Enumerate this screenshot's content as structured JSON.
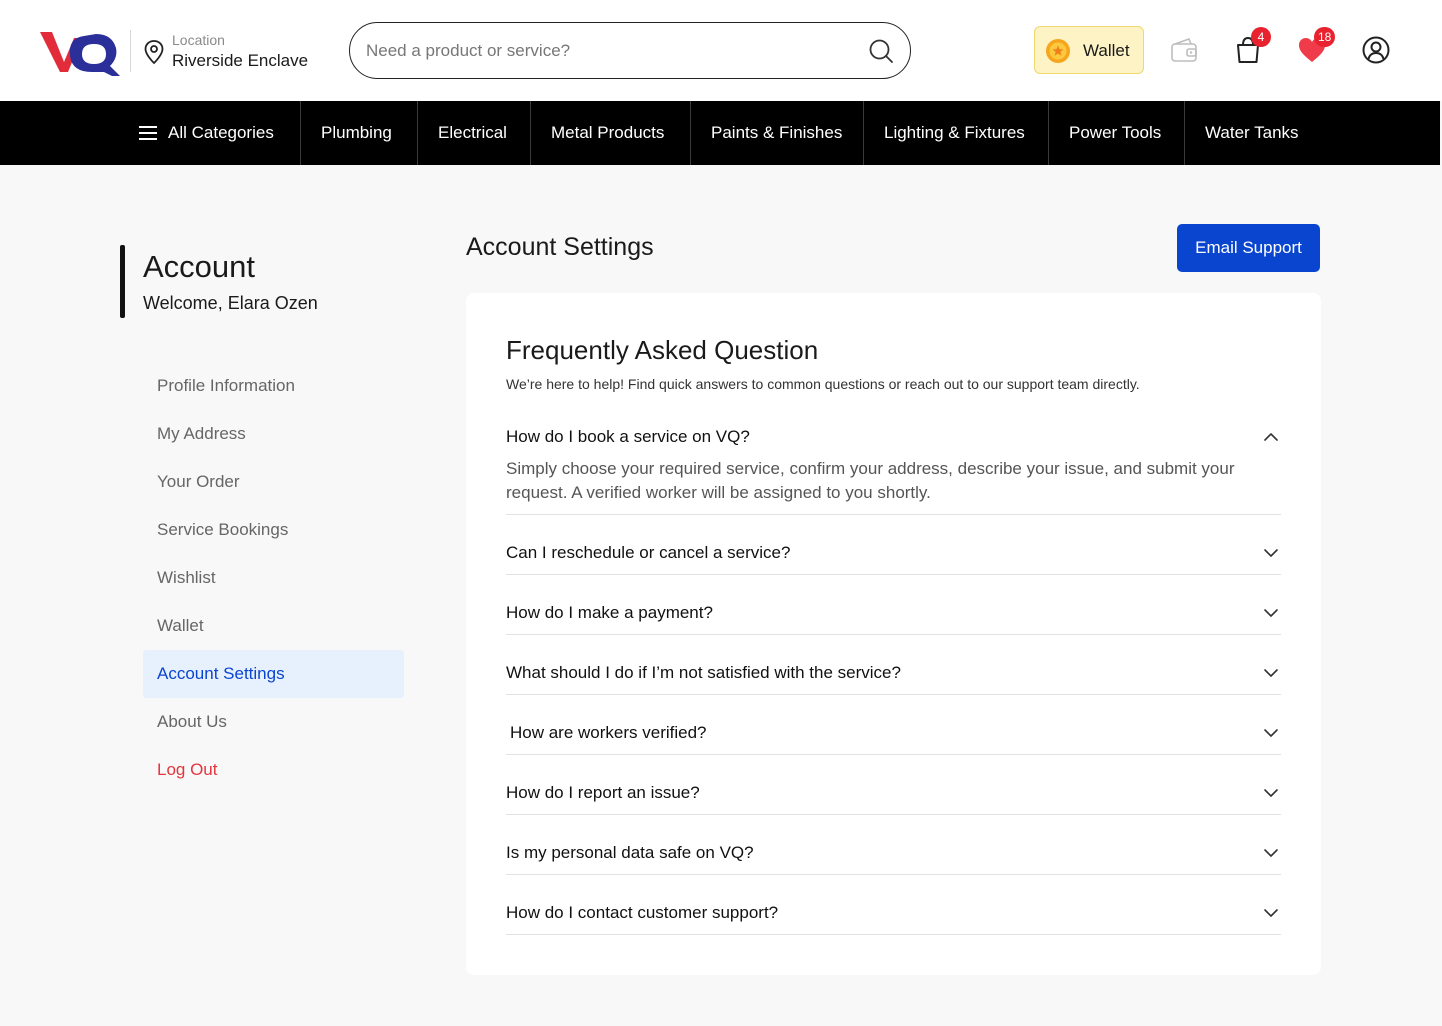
{
  "header": {
    "logo_text": "VQ",
    "location_label": "Location",
    "location_value": "Riverside Enclave",
    "search_placeholder": "Need a product or service?",
    "wallet_label": "Wallet",
    "cart_count": "4",
    "wishlist_count": "18",
    "icons": [
      "location-pin-icon",
      "search-icon",
      "coin-icon",
      "wallet-icon",
      "shopping-bag-icon",
      "heart-icon",
      "user-icon"
    ]
  },
  "nav": {
    "items": [
      "All Categories",
      "Plumbing",
      "Electrical",
      "Metal Products",
      "Paints & Finishes",
      "Lighting & Fixtures",
      "Power Tools",
      "Water Tanks"
    ]
  },
  "sidebar": {
    "title": "Account",
    "welcome": "Welcome, Elara Ozen",
    "items": [
      {
        "label": "Profile Information"
      },
      {
        "label": "My Address"
      },
      {
        "label": "Your Order"
      },
      {
        "label": "Service Bookings"
      },
      {
        "label": "Wishlist"
      },
      {
        "label": "Wallet"
      },
      {
        "label": "Account Settings",
        "active": true
      },
      {
        "label": "About Us"
      },
      {
        "label": "Log Out"
      }
    ]
  },
  "main": {
    "title": "Account Settings",
    "email_support": "Email Support",
    "faq_title": "Frequently Asked Question",
    "faq_subtitle": "We’re here to help! Find quick answers to common questions or reach out to our support team directly.",
    "faqs": [
      {
        "q": "How do I book a service on VQ?",
        "a": "Simply choose your required service, confirm your address, describe your issue, and submit your request. A verified worker will be assigned to you shortly.",
        "expanded": true
      },
      {
        "q": "Can I reschedule or cancel a service?"
      },
      {
        "q": "How do I make a payment?"
      },
      {
        "q": "What should I do if I’m not satisfied with the service?"
      },
      {
        "q": "How are workers verified?"
      },
      {
        "q": "How do I report an issue?"
      },
      {
        "q": "Is my personal data safe on VQ?"
      },
      {
        "q": "How do I contact customer support?"
      }
    ]
  },
  "colors": {
    "brand_red": "#e22c3a",
    "brand_blue": "#2a2f9a",
    "accent_blue": "#0a45cf",
    "nav_bg": "#000000",
    "badge_red": "#e8232f",
    "wallet_bg": "#fdf3c4",
    "logout_red": "#e5343f"
  }
}
